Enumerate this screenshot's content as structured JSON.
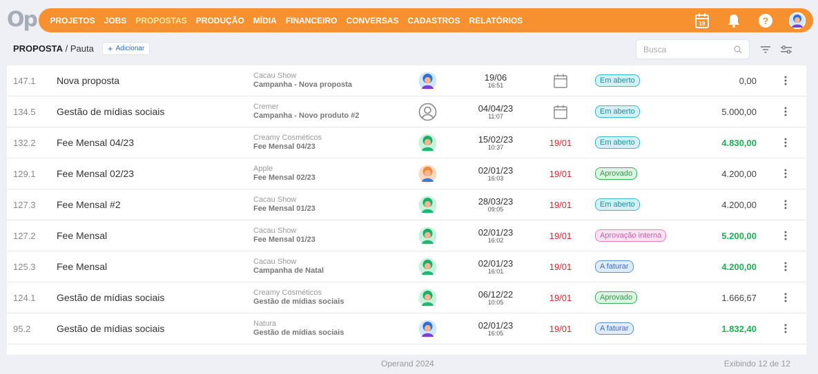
{
  "logo": "Op",
  "menu": [
    "PROJETOS",
    "JOBS",
    "PROPOSTAS",
    "PRODUÇÃO",
    "MÍDIA",
    "FINANCEIRO",
    "CONVERSAS",
    "CADASTROS",
    "RELATÓRIOS"
  ],
  "active_menu": "PROPOSTAS",
  "calendar_day": "19",
  "breadcrumb": {
    "section": "PROPOSTA",
    "sub": "Pauta"
  },
  "add_label": "Adicionar",
  "search_placeholder": "Busca",
  "rows": [
    {
      "code": "147.1",
      "name": "Nova proposta",
      "client": "Cacau Show",
      "project": "Campanha - Nova proposta",
      "avatar": "blue",
      "date": "19/06",
      "time": "16:51",
      "due": "",
      "status": "Em aberto",
      "status_type": "aberto",
      "value": "0,00",
      "value_green": false
    },
    {
      "code": "134.5",
      "name": "Gestão de mídias sociais",
      "client": "Cremer",
      "project": "Campanha - Novo produto #2",
      "avatar": "empty",
      "date": "04/04/23",
      "time": "11:07",
      "due": "",
      "status": "Em aberto",
      "status_type": "aberto",
      "value": "5.000,00",
      "value_green": false
    },
    {
      "code": "132.2",
      "name": "Fee Mensal 04/23",
      "client": "Creamy Cosméticos",
      "project": "Fee Mensal 04/23",
      "avatar": "green",
      "date": "15/02/23",
      "time": "10:37",
      "due": "19/01",
      "status": "Em aberto",
      "status_type": "aberto",
      "value": "4.830,00",
      "value_green": true
    },
    {
      "code": "129.1",
      "name": "Fee Mensal 02/23",
      "client": "Apple",
      "project": "Fee Mensal 02/23",
      "avatar": "orange",
      "date": "02/01/23",
      "time": "16:03",
      "due": "19/01",
      "status": "Aprovado",
      "status_type": "aprovado",
      "value": "4.200,00",
      "value_green": false
    },
    {
      "code": "127.3",
      "name": "Fee Mensal #2",
      "client": "Cacau Show",
      "project": "Fee Mensal 01/23",
      "avatar": "green",
      "date": "28/03/23",
      "time": "09:05",
      "due": "19/01",
      "status": "Em aberto",
      "status_type": "aberto",
      "value": "4.200,00",
      "value_green": false
    },
    {
      "code": "127.2",
      "name": "Fee Mensal",
      "client": "Cacau Show",
      "project": "Fee Mensal 01/23",
      "avatar": "green",
      "date": "02/01/23",
      "time": "16:02",
      "due": "19/01",
      "status": "Aprovação interna",
      "status_type": "interna",
      "value": "5.200,00",
      "value_green": true
    },
    {
      "code": "125.3",
      "name": "Fee Mensal",
      "client": "Cacau Show",
      "project": "Campanha de Natal",
      "avatar": "green",
      "date": "02/01/23",
      "time": "16:01",
      "due": "19/01",
      "status": "A faturar",
      "status_type": "faturar",
      "value": "4.200,00",
      "value_green": true
    },
    {
      "code": "124.1",
      "name": "Gestão de mídias sociais",
      "client": "Creamy Cosméticos",
      "project": "Gestão de mídias sociais",
      "avatar": "green",
      "date": "06/12/22",
      "time": "10:05",
      "due": "19/01",
      "status": "Aprovado",
      "status_type": "aprovado",
      "value": "1.666,67",
      "value_green": false
    },
    {
      "code": "95.2",
      "name": "Gestão de mídias sociais",
      "client": "Natura",
      "project": "Gestão de mídias sociais",
      "avatar": "blue",
      "date": "02/01/23",
      "time": "16:05",
      "due": "19/01",
      "status": "A faturar",
      "status_type": "faturar",
      "value": "1.832,40",
      "value_green": true
    }
  ],
  "footer": {
    "center": "Operand 2024",
    "right": "Exibindo 12 de 12"
  },
  "colors": {
    "brand": "#f7902e",
    "due_red": "#d9272e",
    "value_green": "#1eaf54"
  }
}
